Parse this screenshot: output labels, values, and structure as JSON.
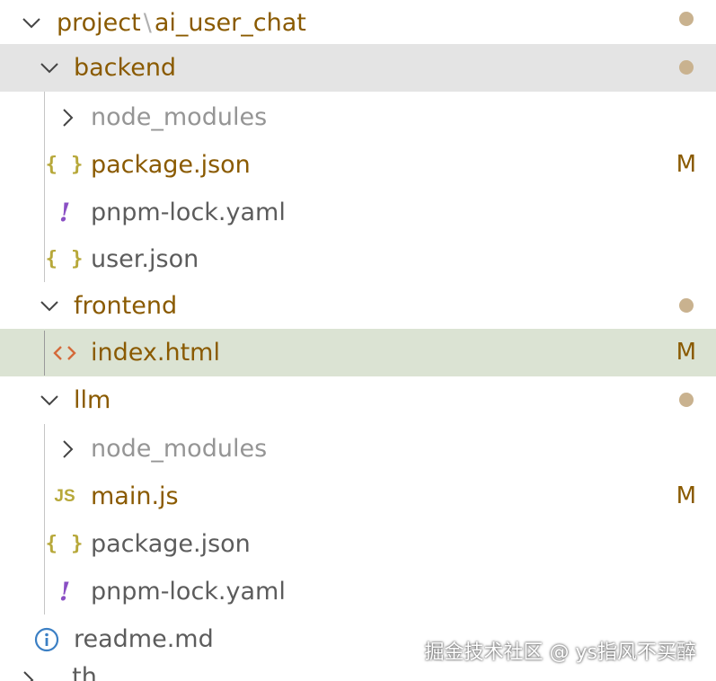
{
  "explorer": {
    "root": {
      "part1": "project",
      "separator": "\\",
      "part2": "ai_user_chat"
    },
    "backend": {
      "name": "backend",
      "children": {
        "node_modules": "node_modules",
        "package_json": "package.json",
        "package_json_status": "M",
        "pnpm_lock": "pnpm-lock.yaml",
        "user_json": "user.json"
      }
    },
    "frontend": {
      "name": "frontend",
      "children": {
        "index_html": "index.html",
        "index_html_status": "M"
      }
    },
    "llm": {
      "name": "llm",
      "children": {
        "node_modules": "node_modules",
        "main_js": "main.js",
        "main_js_status": "M",
        "package_json": "package.json",
        "pnpm_lock": "pnpm-lock.yaml"
      }
    },
    "readme": "readme.md",
    "partial_next": "..th"
  },
  "watermark": "掘金技术社区 @ ys指风不买醉",
  "colors": {
    "folder_text": "#8a5a00",
    "modified_dot": "#c9b28f",
    "selected_bg": "#e4e4e4",
    "active_bg": "#dbe3d3",
    "json_icon": "#b7a83a",
    "yaml_icon": "#8a4fc4",
    "html_icon": "#d46a3a",
    "info_icon": "#3b7fc4"
  },
  "icons": {
    "json": "{ }",
    "yaml": "!",
    "js": "JS"
  }
}
